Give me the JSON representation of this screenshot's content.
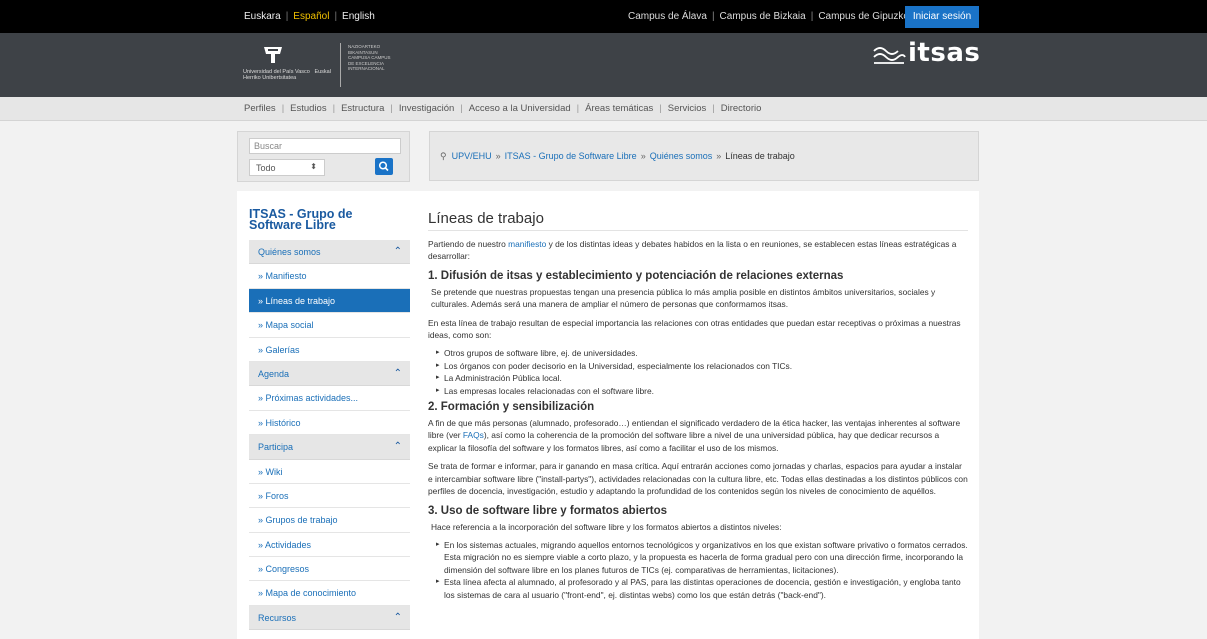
{
  "topbar": {
    "languages": [
      "Euskara",
      "Español",
      "English"
    ],
    "campuses": [
      "Campus de Álava",
      "Campus de Bizkaia",
      "Campus de Gipuzkoa"
    ],
    "login": "Iniciar sesión",
    "active_color": "#f0c000"
  },
  "header": {
    "university": "Universidad del País Vasco",
    "university_eu": "Euskal Herriko Unibertsitatea",
    "campus_text": "NAZIOARTEKO BIKAINTASUN CAMPUSA CAMPUS DE EXCELENCIA INTERNACIONAL",
    "brand": "itsas"
  },
  "nav": {
    "items": [
      "Perfiles",
      "Estudios",
      "Estructura",
      "Investigación",
      "Acceso a la Universidad",
      "Áreas temáticas",
      "Servicios",
      "Directorio"
    ]
  },
  "search": {
    "placeholder": "Buscar",
    "scope": "Todo"
  },
  "breadcrumb": {
    "items": [
      "UPV/EHU",
      "ITSAS - Grupo de Software Libre",
      "Quiénes somos"
    ],
    "current": "Líneas de trabajo"
  },
  "sidebar": {
    "title": "ITSAS - Grupo de Software Libre",
    "items": [
      {
        "label": "Quiénes somos",
        "type": "cat"
      },
      {
        "label": "» Manifiesto",
        "type": "link"
      },
      {
        "label": "» Líneas de trabajo",
        "type": "active"
      },
      {
        "label": "» Mapa social",
        "type": "link"
      },
      {
        "label": "» Galerías",
        "type": "link"
      },
      {
        "label": "Agenda",
        "type": "cat"
      },
      {
        "label": "» Próximas actividades...",
        "type": "link"
      },
      {
        "label": "» Histórico",
        "type": "link"
      },
      {
        "label": "Participa",
        "type": "cat"
      },
      {
        "label": "» Wiki",
        "type": "link"
      },
      {
        "label": "» Foros",
        "type": "link"
      },
      {
        "label": "» Grupos de trabajo",
        "type": "link"
      },
      {
        "label": "» Actividades",
        "type": "link"
      },
      {
        "label": "» Congresos",
        "type": "link"
      },
      {
        "label": "» Mapa de conocimiento",
        "type": "link"
      },
      {
        "label": "Recursos",
        "type": "cat"
      }
    ]
  },
  "content": {
    "title": "Líneas de trabajo",
    "intro_pre": "Partiendo de nuestro ",
    "intro_link": "manifiesto",
    "intro_post": " y de los distintas ideas y debates habidos en la lista o en reuniones, se establecen estas líneas estratégicas a desarrollar:",
    "s1_title": "1. Difusión de itsas y establecimiento y potenciación de relaciones externas",
    "s1_p1": "Se pretende que nuestras propuestas tengan una presencia pública lo más amplia posible en distintos ámbitos universitarios, sociales y culturales. Además será una manera de ampliar el número de personas que conformamos itsas.",
    "s1_p2": "En esta línea de trabajo resultan de especial importancia las relaciones con otras entidades que puedan estar receptivas o próximas a nuestras ideas, como son:",
    "s1_list": [
      "Otros grupos de software libre, ej. de universidades.",
      "Los órganos con poder decisorio en la Universidad, especialmente los relacionados con TICs.",
      "La Administración Pública local.",
      "Las empresas locales relacionadas con el software libre."
    ],
    "s2_title": "2. Formación y sensibilización",
    "s2_p1_pre": "A fin de que más personas (alumnado, profesorado…) entiendan el significado verdadero de la ética hacker, las ventajas inherentes al software libre (ver ",
    "s2_p1_link": "FAQs",
    "s2_p1_post": "), así como la coherencia de la promoción del software libre a nivel de una universidad pública, hay que dedicar recursos a explicar la filosofía del software y los formatos libres, así como a facilitar el uso de los mismos.",
    "s2_p2": "Se trata de formar e informar, para ir ganando en masa crítica. Aquí entrarán acciones como jornadas y charlas, espacios para ayudar a instalar e intercambiar software libre (\"install-partys\"), actividades relacionadas con la cultura libre, etc. Todas ellas destinadas a los distintos públicos con perfiles de docencia, investigación, estudio y adaptando la profundidad de los contenidos según los niveles de conocimiento de aquéllos.",
    "s3_title": "3. Uso de software libre y formatos abiertos",
    "s3_p1": "Hace referencia a la incorporación del software libre y los formatos abiertos a distintos niveles:",
    "s3_list": [
      "En los sistemas actuales, migrando aquellos entornos tecnológicos y organizativos en los que existan software privativo o formatos cerrados. Esta migración no es siempre viable a corto plazo, y la propuesta es hacerla de forma gradual pero con una dirección firme, incorporando la dimensión del software libre en los planes futuros de TICs (ej. comparativas de herramientas, licitaciones).",
      "Esta línea afecta al alumnado, al profesorado y al PAS, para las distintas operaciones de docencia, gestión e investigación, y engloba tanto los sistemas de cara al usuario (\"front-end\", ej. distintas webs) como los que están detrás (\"back-end\")."
    ]
  }
}
